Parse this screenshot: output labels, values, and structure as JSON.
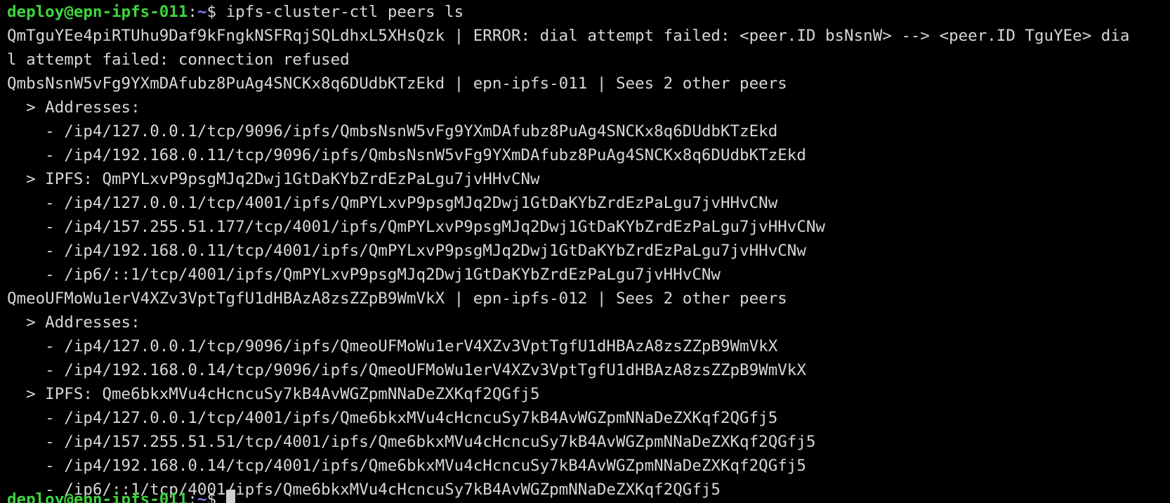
{
  "terminal": {
    "prompt": {
      "user_host": "deploy@epn-ipfs-011",
      "colon": ":",
      "path": "~",
      "symbol": "$ "
    },
    "command": "ipfs-cluster-ctl peers ls",
    "output_lines": [
      "QmTguYEe4piRTUhu9Daf9kFngkNSFRqjSQLdhxL5XHsQzk | ERROR: dial attempt failed: <peer.ID bsNsnW> --> <peer.ID TguYEe> dia",
      "l attempt failed: connection refused",
      "QmbsNsnW5vFg9YXmDAfubz8PuAg4SNCKx8q6DUdbKTzEkd | epn-ipfs-011 | Sees 2 other peers",
      "  > Addresses:",
      "    - /ip4/127.0.0.1/tcp/9096/ipfs/QmbsNsnW5vFg9YXmDAfubz8PuAg4SNCKx8q6DUdbKTzEkd",
      "    - /ip4/192.168.0.11/tcp/9096/ipfs/QmbsNsnW5vFg9YXmDAfubz8PuAg4SNCKx8q6DUdbKTzEkd",
      "  > IPFS: QmPYLxvP9psgMJq2Dwj1GtDaKYbZrdEzPaLgu7jvHHvCNw",
      "    - /ip4/127.0.0.1/tcp/4001/ipfs/QmPYLxvP9psgMJq2Dwj1GtDaKYbZrdEzPaLgu7jvHHvCNw",
      "    - /ip4/157.255.51.177/tcp/4001/ipfs/QmPYLxvP9psgMJq2Dwj1GtDaKYbZrdEzPaLgu7jvHHvCNw",
      "    - /ip4/192.168.0.11/tcp/4001/ipfs/QmPYLxvP9psgMJq2Dwj1GtDaKYbZrdEzPaLgu7jvHHvCNw",
      "    - /ip6/::1/tcp/4001/ipfs/QmPYLxvP9psgMJq2Dwj1GtDaKYbZrdEzPaLgu7jvHHvCNw",
      "QmeoUFMoWu1erV4XZv3VptTgfU1dHBAzA8zsZZpB9WmVkX | epn-ipfs-012 | Sees 2 other peers",
      "  > Addresses:",
      "    - /ip4/127.0.0.1/tcp/9096/ipfs/QmeoUFMoWu1erV4XZv3VptTgfU1dHBAzA8zsZZpB9WmVkX",
      "    - /ip4/192.168.0.14/tcp/9096/ipfs/QmeoUFMoWu1erV4XZv3VptTgfU1dHBAzA8zsZZpB9WmVkX",
      "  > IPFS: Qme6bkxMVu4cHcncuSy7kB4AvWGZpmNNaDeZXKqf2QGfj5",
      "    - /ip4/127.0.0.1/tcp/4001/ipfs/Qme6bkxMVu4cHcncuSy7kB4AvWGZpmNNaDeZXKqf2QGfj5",
      "    - /ip4/157.255.51.51/tcp/4001/ipfs/Qme6bkxMVu4cHcncuSy7kB4AvWGZpmNNaDeZXKqf2QGfj5",
      "    - /ip4/192.168.0.14/tcp/4001/ipfs/Qme6bkxMVu4cHcncuSy7kB4AvWGZpmNNaDeZXKqf2QGfj5",
      "    - /ip6/::1/tcp/4001/ipfs/Qme6bkxMVu4cHcncuSy7kB4AvWGZpmNNaDeZXKqf2QGfj5"
    ],
    "colors": {
      "background": "#000000",
      "foreground": "#d7d7d7",
      "prompt_user": "#3ed53e",
      "prompt_path": "#7f7fff",
      "cursor": "#cfcfcf"
    }
  }
}
